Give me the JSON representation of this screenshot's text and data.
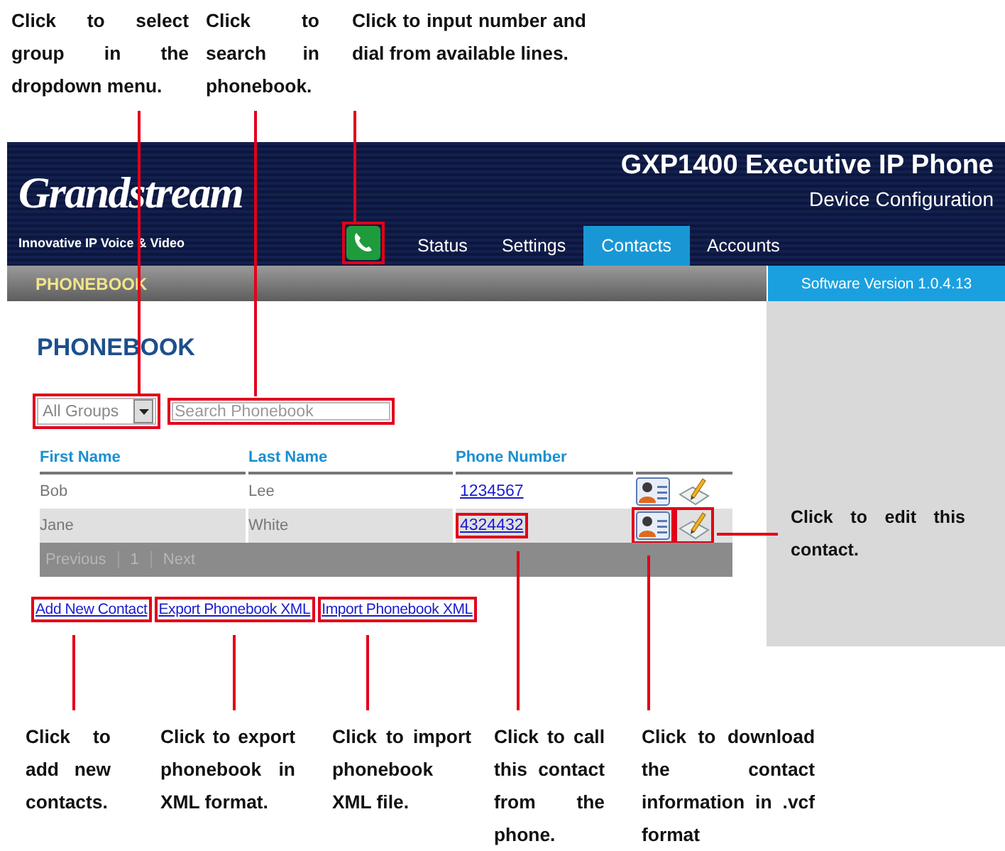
{
  "callouts_top": [
    {
      "text": "Click to select group in the dropdown menu."
    },
    {
      "text": "Click to search in phonebook."
    },
    {
      "text": "Click to input number and dial from available lines."
    }
  ],
  "header": {
    "logo": "Grandstream",
    "tagline": "Innovative IP Voice & Video",
    "title": "GXP1400 Executive IP Phone",
    "subtitle": "Device Configuration",
    "dial_callout": true,
    "tabs": [
      {
        "label": "Status",
        "selected": false
      },
      {
        "label": "Settings",
        "selected": false
      },
      {
        "label": "Contacts",
        "selected": true
      },
      {
        "label": "Accounts",
        "selected": false
      }
    ]
  },
  "breadcrumb": "PHONEBOOK",
  "version": "Software Version 1.0.4.13",
  "heading": "PHONEBOOK",
  "group_select": {
    "value": "All Groups",
    "callout": true
  },
  "search": {
    "placeholder": "Search Phonebook",
    "callout": true
  },
  "table": {
    "columns": [
      "First Name",
      "Last Name",
      "Phone Number"
    ],
    "rows": [
      {
        "first": "Bob",
        "last": "Lee",
        "phone": "1234567",
        "selected": false,
        "callout": false
      },
      {
        "first": "Jane",
        "last": "White",
        "phone": "4324432",
        "selected": true,
        "callout": true
      }
    ]
  },
  "pager": {
    "previous": "Previous",
    "page": "1",
    "next": "Next"
  },
  "links": [
    {
      "label": "Add New Contact",
      "callout": true
    },
    {
      "label": "Export Phonebook XML",
      "callout": true
    },
    {
      "label": "Import Phonebook XML",
      "callout": true
    }
  ],
  "callout_right": "Click to edit this contact.",
  "callouts_bottom": [
    {
      "text": "Click to add new contacts."
    },
    {
      "text": "Click to export phonebook in XML format."
    },
    {
      "text": "Click to import phonebook XML file."
    },
    {
      "text": "Click to call this contact from the phone."
    },
    {
      "text": "Click to download the contact information in .vcf format"
    }
  ]
}
